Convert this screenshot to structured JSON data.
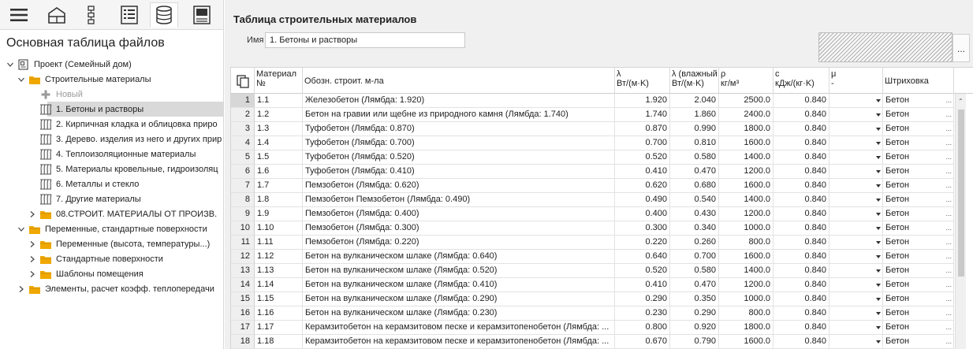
{
  "sidebar": {
    "title": "Основная таблица файлов",
    "toolbar": [
      "menu-icon",
      "house-icon",
      "tree-icon",
      "list-icon",
      "database-icon",
      "panel-icon"
    ],
    "tree": [
      {
        "level": 0,
        "expand": "down",
        "icon": "project",
        "label": "Проект (Семейный дом)"
      },
      {
        "level": 1,
        "expand": "down",
        "icon": "folder",
        "label": "Строительные материалы"
      },
      {
        "level": 2,
        "expand": "none",
        "icon": "plus",
        "label": "Новый",
        "muted": true
      },
      {
        "level": 2,
        "expand": "none",
        "icon": "hatch",
        "label": "1. Бетоны и растворы",
        "selected": true
      },
      {
        "level": 2,
        "expand": "none",
        "icon": "hatch",
        "label": "2. Кирпичная кладка и облицовка приро"
      },
      {
        "level": 2,
        "expand": "none",
        "icon": "hatch",
        "label": "3. Дерево. изделия из него и других прир"
      },
      {
        "level": 2,
        "expand": "none",
        "icon": "hatch",
        "label": "4. Теплоизоляционные материалы"
      },
      {
        "level": 2,
        "expand": "none",
        "icon": "hatch",
        "label": "5. Материалы кровельные, гидроизоляц"
      },
      {
        "level": 2,
        "expand": "none",
        "icon": "hatch",
        "label": "6. Металлы и стекло"
      },
      {
        "level": 2,
        "expand": "none",
        "icon": "hatch",
        "label": "7. Другие материалы"
      },
      {
        "level": 2,
        "expand": "right",
        "icon": "folder",
        "label": "08.СТРОИТ. МАТЕРИАЛЫ ОТ ПРОИЗВ."
      },
      {
        "level": 1,
        "expand": "down",
        "icon": "folder",
        "label": "Переменные, стандартные поверхности"
      },
      {
        "level": 2,
        "expand": "right",
        "icon": "folder",
        "label": "Переменные (высота, температуры...)"
      },
      {
        "level": 2,
        "expand": "right",
        "icon": "folder",
        "label": "Стандартные поверхности"
      },
      {
        "level": 2,
        "expand": "right",
        "icon": "folder",
        "label": "Шаблоны помещения"
      },
      {
        "level": 1,
        "expand": "right",
        "icon": "folder",
        "label": "Элементы, расчет коэфф. теплопередачи"
      }
    ]
  },
  "main": {
    "title": "Таблица строительных материалов",
    "name_label": "Имя",
    "name_value": "1. Бетоны и растворы",
    "dots_label": "...",
    "columns": {
      "material": [
        "Материал",
        "№"
      ],
      "designation": "Обозн. строит. м-ла",
      "lambda": [
        "λ",
        "Вт/(м·K)"
      ],
      "lambda_wet": [
        "λ (влажный",
        "Вт/(м·K)"
      ],
      "rho": [
        "ρ",
        "кг/м³"
      ],
      "c": [
        "c",
        "кДж/(кг·K)"
      ],
      "mu": [
        "μ",
        "-"
      ],
      "hatch": "Штриховка"
    },
    "rows": [
      {
        "n": "1",
        "mat": "1.1",
        "name": "Железобетон (Лямбда: 1.920)",
        "lambda": "1.920",
        "lambda_wet": "2.040",
        "rho": "2500.0",
        "c": "0.840",
        "hatch": "Бетон"
      },
      {
        "n": "2",
        "mat": "1.2",
        "name": "Бетон на гравии или щебне из природного камня (Лямбда: 1.740)",
        "lambda": "1.740",
        "lambda_wet": "1.860",
        "rho": "2400.0",
        "c": "0.840",
        "hatch": "Бетон"
      },
      {
        "n": "3",
        "mat": "1.3",
        "name": "Туфобетон (Лямбда: 0.870)",
        "lambda": "0.870",
        "lambda_wet": "0.990",
        "rho": "1800.0",
        "c": "0.840",
        "hatch": "Бетон"
      },
      {
        "n": "4",
        "mat": "1.4",
        "name": "Туфобетон (Лямбда: 0.700)",
        "lambda": "0.700",
        "lambda_wet": "0.810",
        "rho": "1600.0",
        "c": "0.840",
        "hatch": "Бетон"
      },
      {
        "n": "5",
        "mat": "1.5",
        "name": "Туфобетон (Лямбда: 0.520)",
        "lambda": "0.520",
        "lambda_wet": "0.580",
        "rho": "1400.0",
        "c": "0.840",
        "hatch": "Бетон"
      },
      {
        "n": "6",
        "mat": "1.6",
        "name": "Туфобетон (Лямбда: 0.410)",
        "lambda": "0.410",
        "lambda_wet": "0.470",
        "rho": "1200.0",
        "c": "0.840",
        "hatch": "Бетон"
      },
      {
        "n": "7",
        "mat": "1.7",
        "name": "Пемзобетон (Лямбда: 0.620)",
        "lambda": "0.620",
        "lambda_wet": "0.680",
        "rho": "1600.0",
        "c": "0.840",
        "hatch": "Бетон"
      },
      {
        "n": "8",
        "mat": "1.8",
        "name": "Пемзобетон Пемзобетон (Лямбда: 0.490)",
        "lambda": "0.490",
        "lambda_wet": "0.540",
        "rho": "1400.0",
        "c": "0.840",
        "hatch": "Бетон"
      },
      {
        "n": "9",
        "mat": "1.9",
        "name": "Пемзобетон (Лямбда: 0.400)",
        "lambda": "0.400",
        "lambda_wet": "0.430",
        "rho": "1200.0",
        "c": "0.840",
        "hatch": "Бетон"
      },
      {
        "n": "10",
        "mat": "1.10",
        "name": "Пемзобетон (Лямбда: 0.300)",
        "lambda": "0.300",
        "lambda_wet": "0.340",
        "rho": "1000.0",
        "c": "0.840",
        "hatch": "Бетон"
      },
      {
        "n": "11",
        "mat": "1.11",
        "name": "Пемзобетон (Лямбда: 0.220)",
        "lambda": "0.220",
        "lambda_wet": "0.260",
        "rho": "800.0",
        "c": "0.840",
        "hatch": "Бетон"
      },
      {
        "n": "12",
        "mat": "1.12",
        "name": "Бетон на вулканическом шлаке (Лямбда: 0.640)",
        "lambda": "0.640",
        "lambda_wet": "0.700",
        "rho": "1600.0",
        "c": "0.840",
        "hatch": "Бетон"
      },
      {
        "n": "13",
        "mat": "1.13",
        "name": "Бетон на вулканическом шлаке (Лямбда: 0.520)",
        "lambda": "0.520",
        "lambda_wet": "0.580",
        "rho": "1400.0",
        "c": "0.840",
        "hatch": "Бетон"
      },
      {
        "n": "14",
        "mat": "1.14",
        "name": "Бетон на вулканическом шлаке (Лямбда: 0.410)",
        "lambda": "0.410",
        "lambda_wet": "0.470",
        "rho": "1200.0",
        "c": "0.840",
        "hatch": "Бетон"
      },
      {
        "n": "15",
        "mat": "1.15",
        "name": "Бетон на вулканическом шлаке (Лямбда: 0.290)",
        "lambda": "0.290",
        "lambda_wet": "0.350",
        "rho": "1000.0",
        "c": "0.840",
        "hatch": "Бетон"
      },
      {
        "n": "16",
        "mat": "1.16",
        "name": "Бетон на вулканическом шлаке (Лямбда: 0.230)",
        "lambda": "0.230",
        "lambda_wet": "0.290",
        "rho": "800.0",
        "c": "0.840",
        "hatch": "Бетон"
      },
      {
        "n": "17",
        "mat": "1.17",
        "name": "Керамзитобетон на керамзитовом песке и керамзитопенобетон (Лямбда: ...",
        "lambda": "0.800",
        "lambda_wet": "0.920",
        "rho": "1800.0",
        "c": "0.840",
        "hatch": "Бетон"
      },
      {
        "n": "18",
        "mat": "1.18",
        "name": "Керамзитобетон на керамзитовом песке и керамзитопенобетон (Лямбда: ...",
        "lambda": "0.670",
        "lambda_wet": "0.790",
        "rho": "1600.0",
        "c": "0.840",
        "hatch": "Бетон"
      }
    ]
  },
  "colors": {
    "folder": "#f0a800",
    "selection": "#d9d9d9",
    "panel": "#f0f0f0"
  }
}
